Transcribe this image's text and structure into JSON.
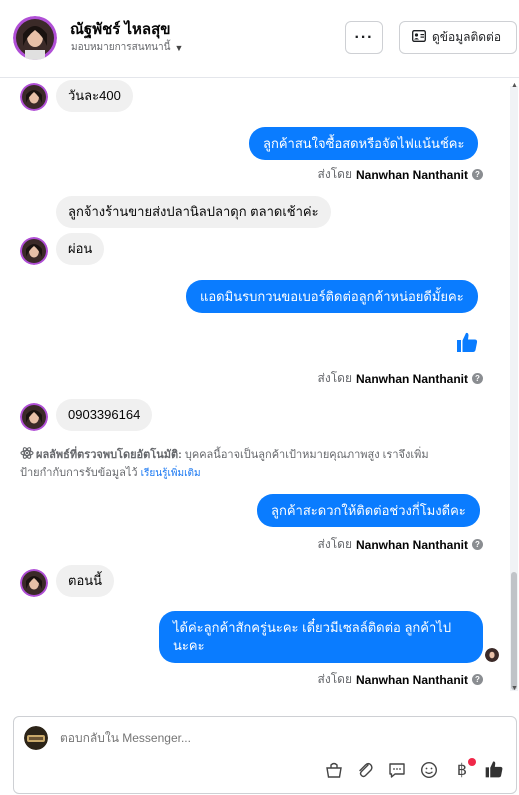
{
  "header": {
    "name": "ณัฐพัชร์ ไหลสุข",
    "assignment": "มอบหมายการสนทนานี้",
    "more_label": "···",
    "contact_button": "ดูข้อมูลติดต่อ"
  },
  "messages": {
    "m1": "วันละ400",
    "m2": "ลูกค้าสนใจซื้อสดหรือจัดไฟแน้นช์คะ",
    "m3a": "ลูกจ้างร้านขายส่งปลานิลปลาดุก ตลาดเช้าค่ะ",
    "m3b": "ผ่อน",
    "m4": "แอดมินรบกวนขอเบอร์ติดต่อลูกค้าหน่อยดีมั้ยคะ",
    "m5": "0903396164",
    "m6": "ลูกค้าสะดวกให้ติดต่อช่วงกี่โมงดีคะ",
    "m7": "ตอนนี้",
    "m8_line1": "ได้ค่ะลูกค้าสักครู่นะคะ เดี๋ยวมีเซลล์ติดต่อ ลูกค้าไป",
    "m8_line2": "นะคะ"
  },
  "sent_by": {
    "prefix": "ส่งโดย",
    "name": "Nanwhan Nanthanit"
  },
  "ai_note": {
    "label": "ผลลัพธ์ที่ตรวจพบโดยอัตโนมัติ:",
    "text_line1": " บุคคลนี้อาจเป็นลูกค้าเป้าหมายคุณภาพสูง เราจึงเพิ่ม",
    "text_line2": "ป้ายกำกับการรับข้อมูลไว้ ",
    "link": "เรียนรู้เพิ่มเติม"
  },
  "composer": {
    "placeholder": "ตอบกลับใน Messenger..."
  },
  "colors": {
    "outgoing_bubble": "#0a7cff",
    "incoming_bubble": "#f0f0f0",
    "link": "#1877f2",
    "notification_dot": "#f02849"
  },
  "icons": {
    "like": "thumbs-up-icon",
    "info": "info-icon",
    "ai": "atom-icon",
    "basket": "shopping-basket-icon",
    "attach": "paperclip-icon",
    "saved_replies": "chat-bubble-icon",
    "emoji": "smiley-icon",
    "payments": "baht-icon"
  }
}
